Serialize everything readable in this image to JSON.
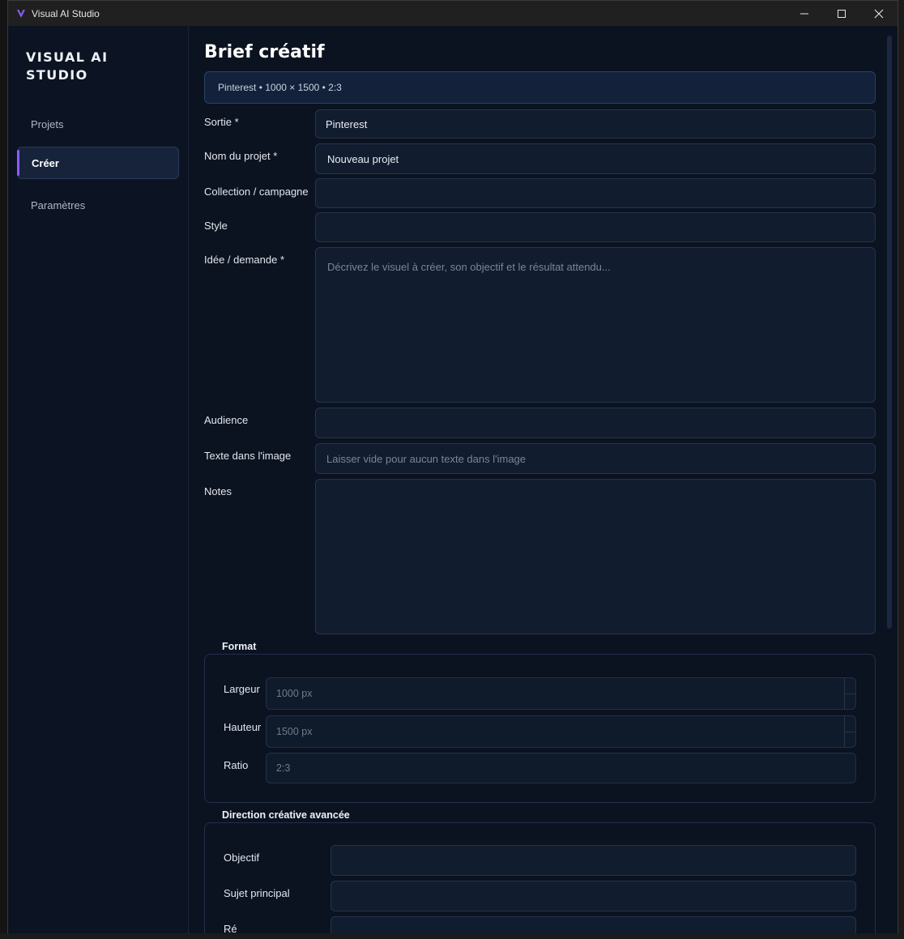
{
  "window": {
    "title": "Visual AI Studio"
  },
  "sidebar": {
    "brand": "VISUAL AI STUDIO",
    "items": [
      {
        "label": "Projets",
        "active": false
      },
      {
        "label": "Créer",
        "active": true
      },
      {
        "label": "Paramètres",
        "active": false
      }
    ]
  },
  "brief": {
    "title": "Brief créatif",
    "summary": "Pinterest • 1000 × 1500 • 2:3",
    "fields": {
      "sortie": {
        "label": "Sortie *",
        "value": "Pinterest"
      },
      "nom": {
        "label": "Nom du projet *",
        "value": "Nouveau projet"
      },
      "collection": {
        "label": "Collection / campagne",
        "value": ""
      },
      "style": {
        "label": "Style",
        "value": ""
      },
      "idee": {
        "label": "Idée / demande *",
        "value": "",
        "placeholder": "Décrivez le visuel à créer, son objectif et le résultat attendu..."
      },
      "audience": {
        "label": "Audience",
        "value": ""
      },
      "texte": {
        "label": "Texte dans l'image",
        "value": "",
        "placeholder": "Laisser vide pour aucun texte dans l'image"
      },
      "notes": {
        "label": "Notes",
        "value": ""
      }
    }
  },
  "format": {
    "title": "Format",
    "largeur": {
      "label": "Largeur",
      "value": "1000 px"
    },
    "hauteur": {
      "label": "Hauteur",
      "value": "1500 px"
    },
    "ratio": {
      "label": "Ratio",
      "value": "2:3"
    }
  },
  "direction": {
    "title": "Direction créative avancée",
    "objectif": {
      "label": "Objectif",
      "value": ""
    },
    "sujet": {
      "label": "Sujet principal",
      "value": ""
    },
    "partial_label": "Ré"
  },
  "colors": {
    "accent": "#8b5cf6",
    "background": "#0b1220",
    "sidebar": "#0c1322",
    "field": "#111c2e"
  }
}
